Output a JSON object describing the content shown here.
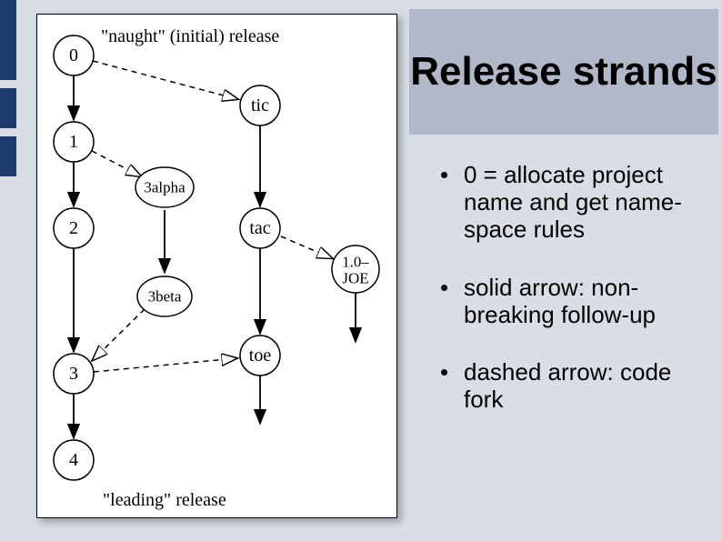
{
  "title": "Release strands",
  "bullets": [
    "0 = allocate project name and get name-space rules",
    "solid arrow: non-breaking follow-up",
    "dashed arrow: code fork"
  ],
  "diagram": {
    "caption_top": "\"naught\" (initial) release",
    "caption_bottom": "\"leading\" release",
    "nodes": {
      "n0": "0",
      "n1": "1",
      "n2": "2",
      "n3": "3",
      "n4": "4",
      "tic": "tic",
      "tac": "tac",
      "toe": "toe",
      "a3": "3alpha",
      "b3": "3beta",
      "joe1": "1.0–",
      "joe2": "JOE"
    }
  }
}
